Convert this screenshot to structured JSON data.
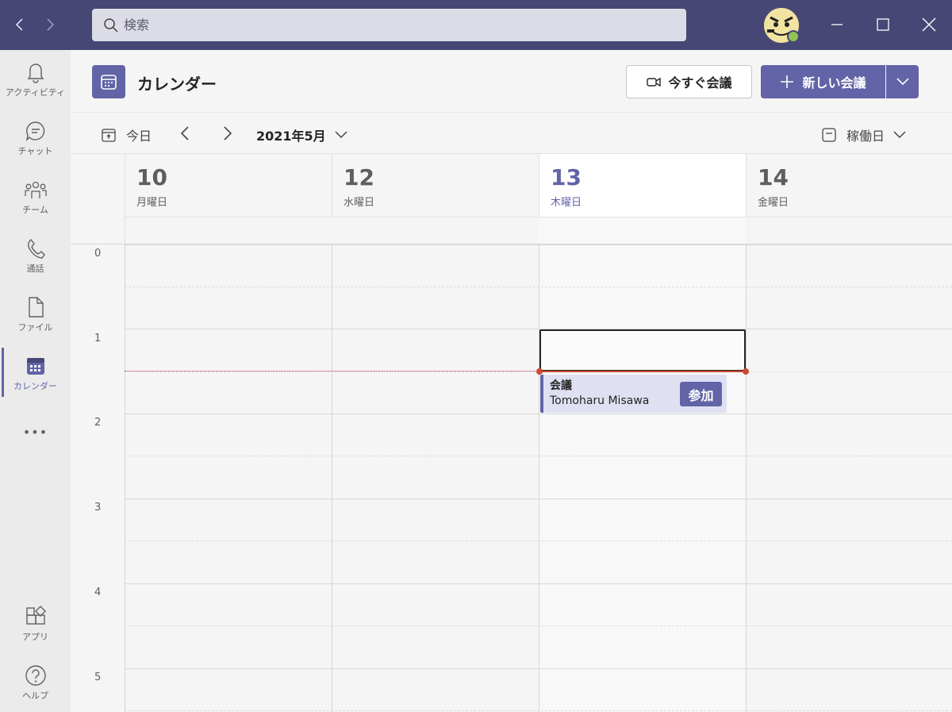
{
  "window": {
    "search_placeholder": "検索"
  },
  "rail": {
    "items": [
      {
        "label": "アクティビティ",
        "icon": "bell-icon"
      },
      {
        "label": "チャット",
        "icon": "chat-icon"
      },
      {
        "label": "チーム",
        "icon": "teams-icon"
      },
      {
        "label": "通話",
        "icon": "phone-icon"
      },
      {
        "label": "ファイル",
        "icon": "file-icon"
      },
      {
        "label": "カレンダー",
        "icon": "calendar-icon"
      },
      {
        "label": "アプリ",
        "icon": "apps-icon"
      },
      {
        "label": "ヘルプ",
        "icon": "help-icon"
      }
    ],
    "more_label": "•••"
  },
  "header": {
    "title": "カレンダー",
    "meet_now_label": "今すぐ会議",
    "new_meeting_label": "新しい会議"
  },
  "toolbar": {
    "today_label": "今日",
    "month_label": "2021年5月",
    "view_label": "稼働日"
  },
  "days": [
    {
      "num": "10",
      "weekday": "月曜日"
    },
    {
      "num": "12",
      "weekday": "水曜日"
    },
    {
      "num": "13",
      "weekday": "木曜日"
    },
    {
      "num": "14",
      "weekday": "金曜日"
    }
  ],
  "hours": [
    "0",
    "1",
    "2",
    "3",
    "4",
    "5"
  ],
  "event": {
    "title": "会議",
    "organizer": "Tomoharu Misawa",
    "join_label": "参加"
  },
  "colors": {
    "titlebar": "#464775",
    "accent": "#6264a7",
    "now_line": "#cc4a31"
  }
}
